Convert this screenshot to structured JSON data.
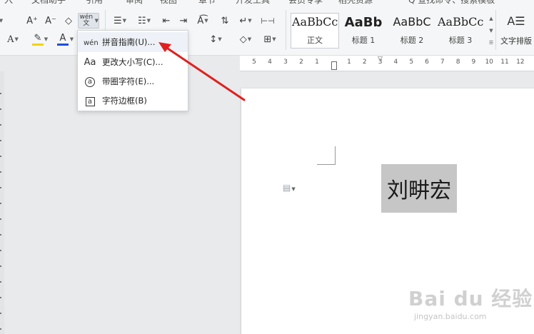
{
  "menu_top": [
    "入",
    "文档助手",
    "引用",
    "审阅",
    "视图",
    "章节",
    "开发工具",
    "会员专享",
    "稻壳资源",
    "Q 查找命令、搜索模板"
  ],
  "toolbar": {
    "row1": {
      "font_grow": "A⁺",
      "font_shrink": "A⁻",
      "clear_format": "◇",
      "phonetic_guide": "wén 文",
      "bullets": "☰",
      "numbering": "☷",
      "indent_decrease": "⇤",
      "indent_increase": "⇥",
      "chinese_layout": "A͡",
      "sort": "⇅",
      "show_marks": "↵",
      "distribute": "⊢⊣"
    },
    "row2": {
      "text_effect": "A",
      "highlight": "✎",
      "font_color": "A",
      "line_spacing": "↕",
      "shading": "◇",
      "borders": "⊞"
    }
  },
  "styles": [
    {
      "sample": "AaBbCcDd",
      "name": "正文"
    },
    {
      "sample": "AaBb",
      "name": "标题 1"
    },
    {
      "sample": "AaBbC",
      "name": "标题 2"
    },
    {
      "sample": "AaBbCcD",
      "name": "标题 3"
    }
  ],
  "text_layout": {
    "label": "文字排版"
  },
  "ruler": [
    "5",
    "4",
    "3",
    "2",
    "1",
    "1",
    "2",
    "3",
    "4",
    "5",
    "6",
    "7",
    "8",
    "9",
    "10",
    "11",
    "12"
  ],
  "dropdown": {
    "items": [
      {
        "icon": "wén",
        "label": "拼音指南(U)..."
      },
      {
        "icon": "Aa",
        "label": "更改大小写(C)..."
      },
      {
        "icon": "a",
        "label": "带圈字符(E)..."
      },
      {
        "icon": "a",
        "label": "字符边框(B)"
      }
    ]
  },
  "document": {
    "selected_text": "刘畊宏"
  },
  "watermark": {
    "logo": "Bai du 经验",
    "url": "jingyan.baidu.com"
  },
  "colors": {
    "highlight": "#f2d200",
    "font_color": "#1f4fd8",
    "arrow": "#e02020",
    "selection": "#c6c6c6"
  }
}
